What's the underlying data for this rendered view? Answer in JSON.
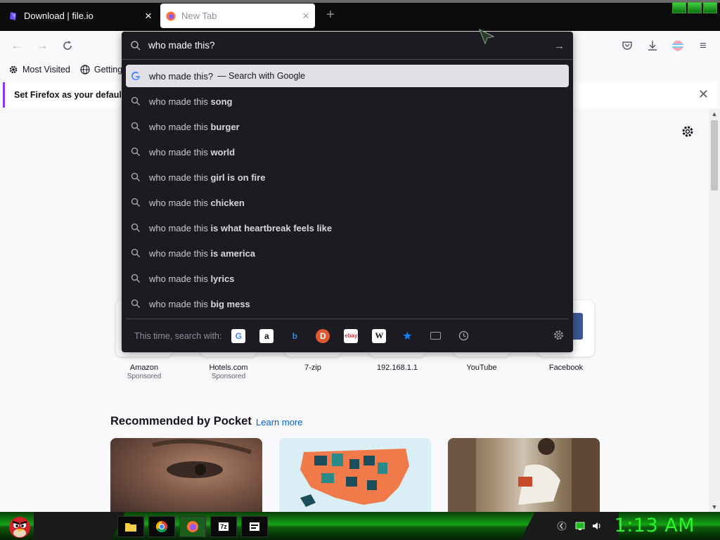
{
  "tabs": [
    {
      "title": "Download | file.io",
      "active": false
    },
    {
      "title": "New Tab",
      "active": true
    }
  ],
  "bookmarks": [
    {
      "label": "Most Visited"
    },
    {
      "label": "Getting"
    }
  ],
  "notification": {
    "text": "Set Firefox as your default b"
  },
  "urlbar": {
    "value": "who made this?",
    "selected_suggestion": {
      "text": "who made this?",
      "action": "— Search with Google"
    },
    "suggestions": [
      {
        "prefix": "who made this ",
        "bold": "song"
      },
      {
        "prefix": "who made this ",
        "bold": "burger"
      },
      {
        "prefix": "who made this ",
        "bold": "world"
      },
      {
        "prefix": "who made this ",
        "bold": "girl is on fire"
      },
      {
        "prefix": "who made this ",
        "bold": "chicken"
      },
      {
        "prefix": "who made this ",
        "bold": "is what heartbreak feels like"
      },
      {
        "prefix": "who made this ",
        "bold": "is america"
      },
      {
        "prefix": "who made this ",
        "bold": "lyrics"
      },
      {
        "prefix": "who made this ",
        "bold": "big mess"
      }
    ],
    "one_off_label": "This time, search with:",
    "engines": [
      "google",
      "amazon",
      "bing",
      "duckduckgo",
      "ebay",
      "wikipedia",
      "bookmarks",
      "tabs",
      "history"
    ]
  },
  "shortcuts": [
    {
      "label": "Amazon",
      "sponsored": "Sponsored"
    },
    {
      "label": "Hotels.com",
      "sponsored": "Sponsored"
    },
    {
      "label": "7-zip",
      "sponsored": ""
    },
    {
      "label": "192.168.1.1",
      "sponsored": ""
    },
    {
      "label": "YouTube",
      "sponsored": ""
    },
    {
      "label": "Facebook",
      "sponsored": ""
    }
  ],
  "pocket": {
    "title": "Recommended by Pocket",
    "link": "Learn more"
  },
  "taskbar": {
    "clock": "1:13 AM"
  },
  "colors": {
    "accent": "#8a33ff",
    "link": "#0061e0",
    "clock": "#2cf22c",
    "panel": "#1c1b22"
  }
}
